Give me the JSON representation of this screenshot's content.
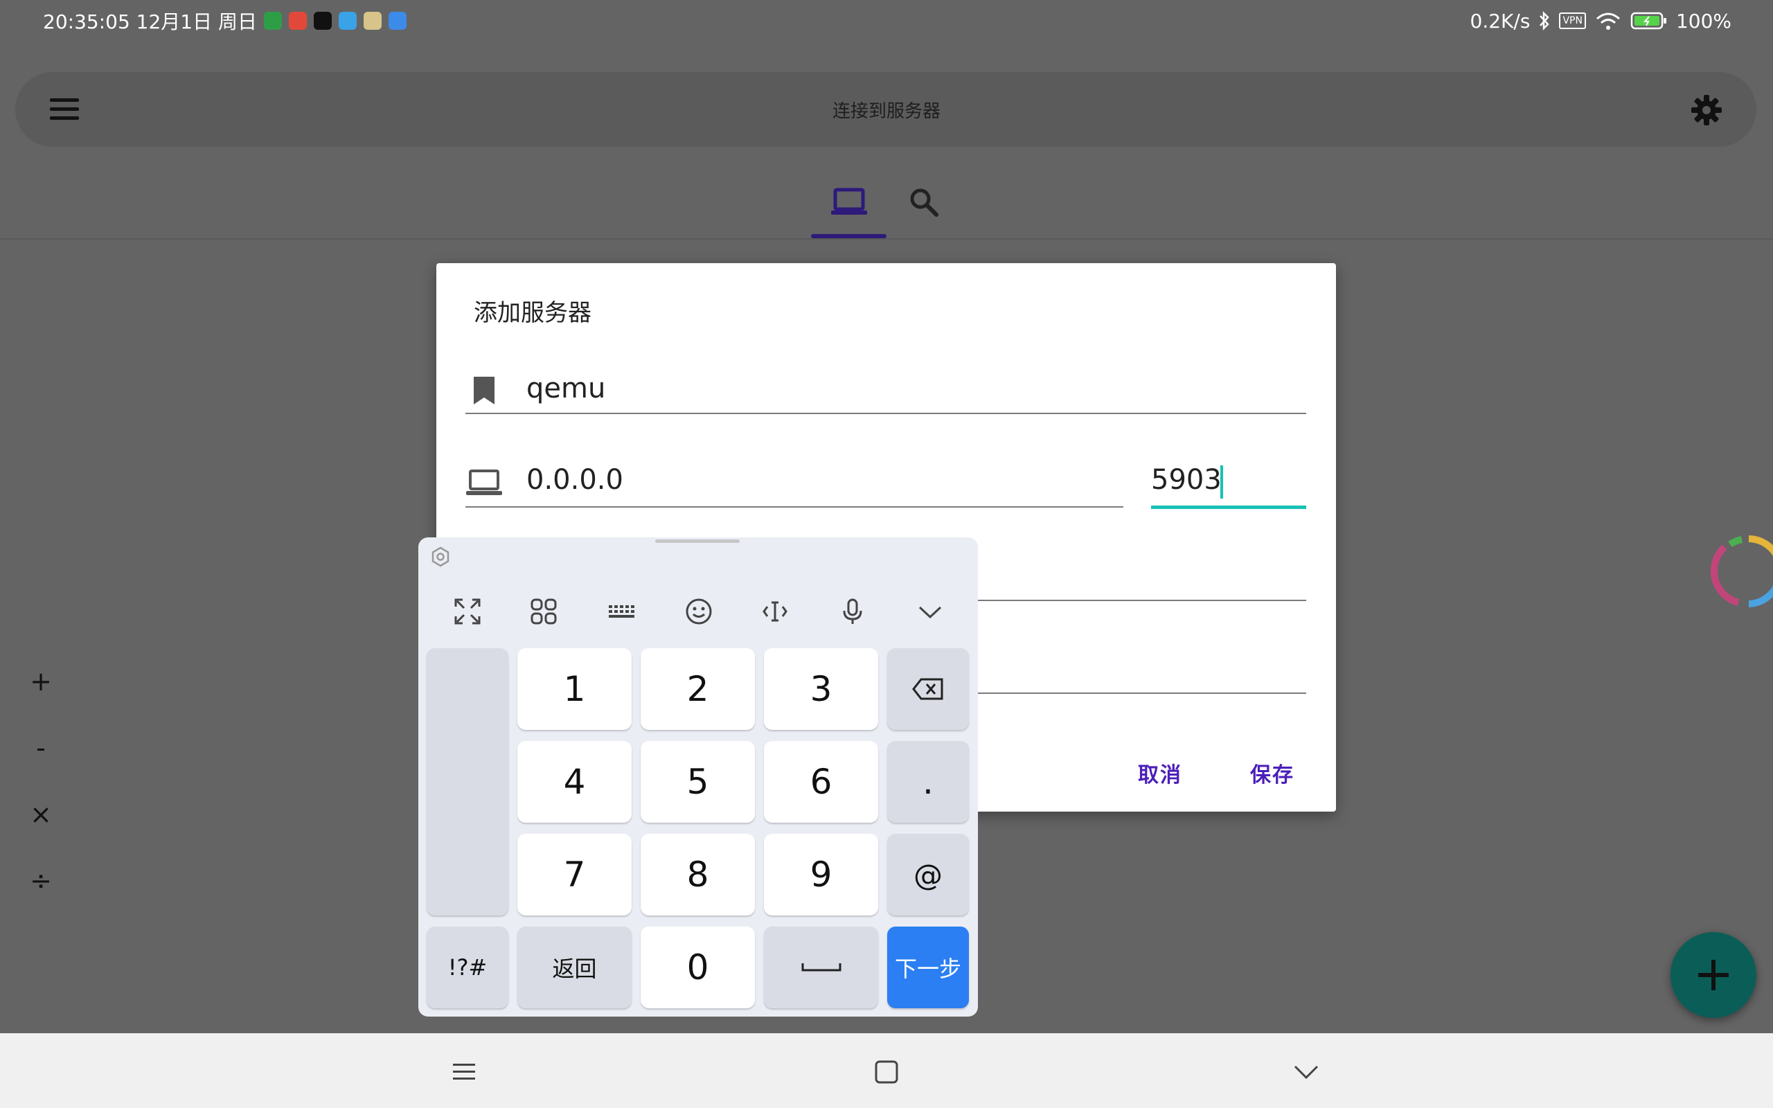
{
  "status_bar": {
    "time_date": "20:35:05 12月1日 周日",
    "notification_icons": [
      "shield-app-icon",
      "video-app-icon",
      "terminal-app-icon",
      "browser-app-icon",
      "game-app-icon",
      "calendar-app-icon"
    ],
    "net_speed": "0.2K/s",
    "vpn": "VPN",
    "battery": "100%"
  },
  "appbar": {
    "title": "连接到服务器"
  },
  "tabs": [
    {
      "name": "servers",
      "icon": "laptop-icon",
      "selected": true
    },
    {
      "name": "discover",
      "icon": "search-icon",
      "selected": false
    }
  ],
  "dialog": {
    "title": "添加服务器",
    "name_value": "qemu",
    "host_value": "0.0.0.0",
    "port_value": "5903",
    "cancel_label": "取消",
    "save_label": "保存"
  },
  "keyboard": {
    "ops": [
      "+",
      "-",
      "×",
      "÷"
    ],
    "keys": {
      "k1": "1",
      "k2": "2",
      "k3": "3",
      "k4": "4",
      "k5": "5",
      "k6": "6",
      "dot": ".",
      "k7": "7",
      "k8": "8",
      "k9": "9",
      "at": "@",
      "sym": "!?#",
      "back": "返回",
      "k0": "0",
      "next": "下一步"
    }
  },
  "colors": {
    "accent": "#17c1b6",
    "button_text": "#4b1fb8",
    "fab": "#0b5e57",
    "keyboard_primary": "#2b7ff2"
  }
}
